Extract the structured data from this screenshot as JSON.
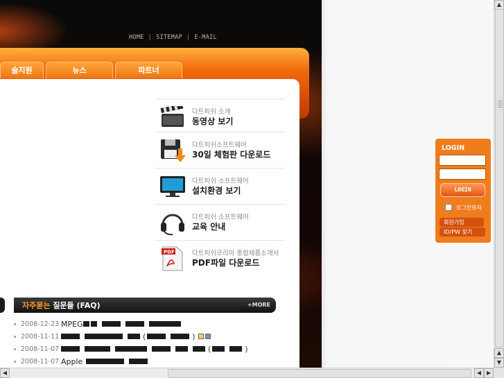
{
  "top_nav": {
    "home": "HOME",
    "sitemap": "SITEMAP",
    "email": "E-MAIL",
    "separator": "|"
  },
  "tabs": [
    {
      "label": "술지원"
    },
    {
      "label": "뉴스"
    },
    {
      "label": "파트너"
    }
  ],
  "promos": [
    {
      "sub": "다트피쉬 소개",
      "main": "동영상 보기",
      "icon": "clapperboard-icon"
    },
    {
      "sub": "다트피쉬소프트웨어",
      "main": "30일 체험판 다운로드",
      "icon": "floppy-download-icon"
    },
    {
      "sub": "다트피쉬 소프트웨어",
      "main": "설치환경 보기",
      "icon": "monitor-icon"
    },
    {
      "sub": "다트피쉬 소프트웨어",
      "main": "교육 안내",
      "icon": "headset-icon"
    },
    {
      "sub": "다트피쉬코리아 종합제품소개서",
      "main": "PDF파일 다운로드",
      "icon": "pdf-icon"
    }
  ],
  "faq": {
    "title_highlight": "자주묻는",
    "title_rest": " 질문들 (FAQ)",
    "more": "+MORE",
    "rows": [
      {
        "date": "2008-12-23",
        "prefix": "MPEG"
      },
      {
        "date": "2008-11-11",
        "prefix": ""
      },
      {
        "date": "2008-11-07",
        "prefix": ""
      },
      {
        "date": "2008-11-07",
        "prefix": "Apple"
      }
    ]
  },
  "login": {
    "title": "LOGIN",
    "button": "LOGIN",
    "remember": "로그인유지",
    "signup": "회원가입",
    "find": "ID/PW 찾기"
  },
  "colors": {
    "accent": "#f07d1c",
    "faq_highlight": "#ff9a2a"
  }
}
